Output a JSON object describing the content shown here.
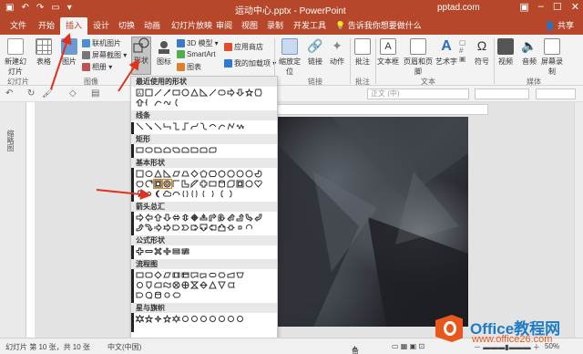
{
  "window": {
    "title": "运动中心.pptx - PowerPoint",
    "site": "pptad.com"
  },
  "tabs": [
    "文件",
    "开始",
    "插入",
    "设计",
    "切换",
    "动画",
    "幻灯片放映",
    "审阅",
    "视图",
    "录制",
    "开发工具"
  ],
  "tell_me": "告诉我你想要做什么",
  "share": "共享",
  "ribbon": {
    "new_slide": "新建幻灯片",
    "table": "表格",
    "image": "图片",
    "online_picture": "联机图片",
    "screenshot": "屏幕截图",
    "album": "相册",
    "shapes": "形状",
    "icons": "图标",
    "model3d": "3D 模型",
    "smartart": "SmartArt",
    "chart": "图表",
    "store": "应用商店",
    "my_addins": "我的加载项",
    "zoom": "缩放定位",
    "link": "链接",
    "action": "动作",
    "comment": "批注",
    "textbox": "文本框",
    "header_footer": "页眉和页脚",
    "wordart": "艺术字",
    "symbol": "符号",
    "video": "视频",
    "audio": "音频",
    "screen_record": "屏幕录制",
    "groups": {
      "slides": "幻灯片",
      "images": "图像",
      "links": "链接",
      "comments": "批注",
      "text": "文本",
      "media": "媒体"
    }
  },
  "toolbar2": {
    "font_placeholder": "正文 (中)"
  },
  "left_pane": {
    "label": "缩略图"
  },
  "shapes_menu": {
    "sections": [
      "最近使用的形状",
      "线条",
      "矩形",
      "基本形状",
      "箭头总汇",
      "公式形状",
      "流程图",
      "星与旗帜"
    ]
  },
  "status": {
    "slide_info": "幻灯片 第 10 张，共 10 张",
    "language": "中文(中国)",
    "notes": "备注",
    "zoom": "50%"
  },
  "watermark": {
    "brand": "Office教程网",
    "url": "www.office26.com"
  },
  "colors": {
    "accent": "#b7472a",
    "highlight": "#fbe3c4",
    "arrow": "#e0301e"
  }
}
